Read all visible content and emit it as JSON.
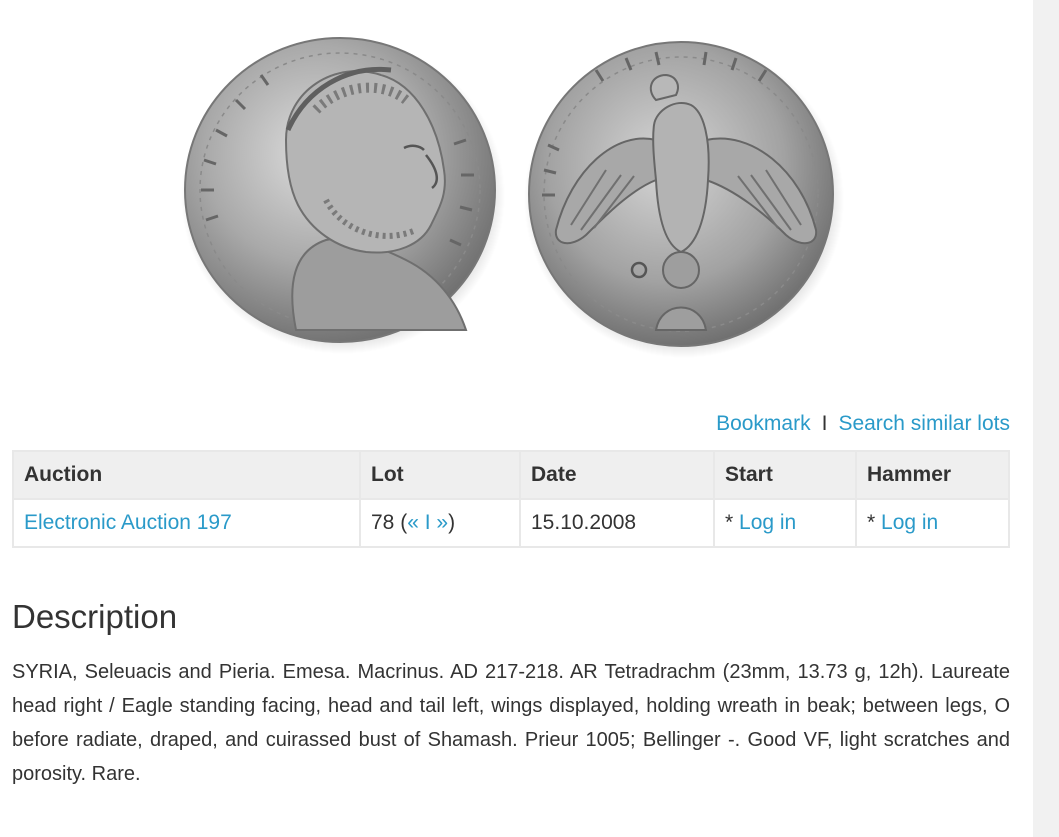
{
  "images": {
    "obverse_alt": "coin-obverse",
    "reverse_alt": "coin-reverse"
  },
  "actions": {
    "bookmark": "Bookmark",
    "separator": "I",
    "search_similar": "Search similar lots"
  },
  "table": {
    "headers": [
      "Auction",
      "Lot",
      "Date",
      "Start",
      "Hammer"
    ],
    "row": {
      "auction": "Electronic Auction 197",
      "lot_number": "78 (",
      "lot_prev": "«",
      "lot_sep": " I ",
      "lot_next": "»",
      "lot_close": ")",
      "date": "15.10.2008",
      "start_prefix": "* ",
      "start_link": "Log in",
      "hammer_prefix": "* ",
      "hammer_link": "Log in"
    }
  },
  "description": {
    "title": "Description",
    "text": "SYRIA, Seleuacis and Pieria. Emesa. Macrinus. AD 217-218. AR Tetradrachm (23mm, 13.73 g, 12h). Laureate head right / Eagle standing facing, head and tail left, wings displayed, holding wreath in beak; between legs, O before radiate, draped, and cuirassed bust of Shamash. Prieur 1005; Bellinger -. Good VF, light scratches and porosity. Rare."
  },
  "colors": {
    "link": "#2a9ac9",
    "header_bg": "#efefef",
    "border": "#e8e8e8",
    "text": "#333333"
  }
}
